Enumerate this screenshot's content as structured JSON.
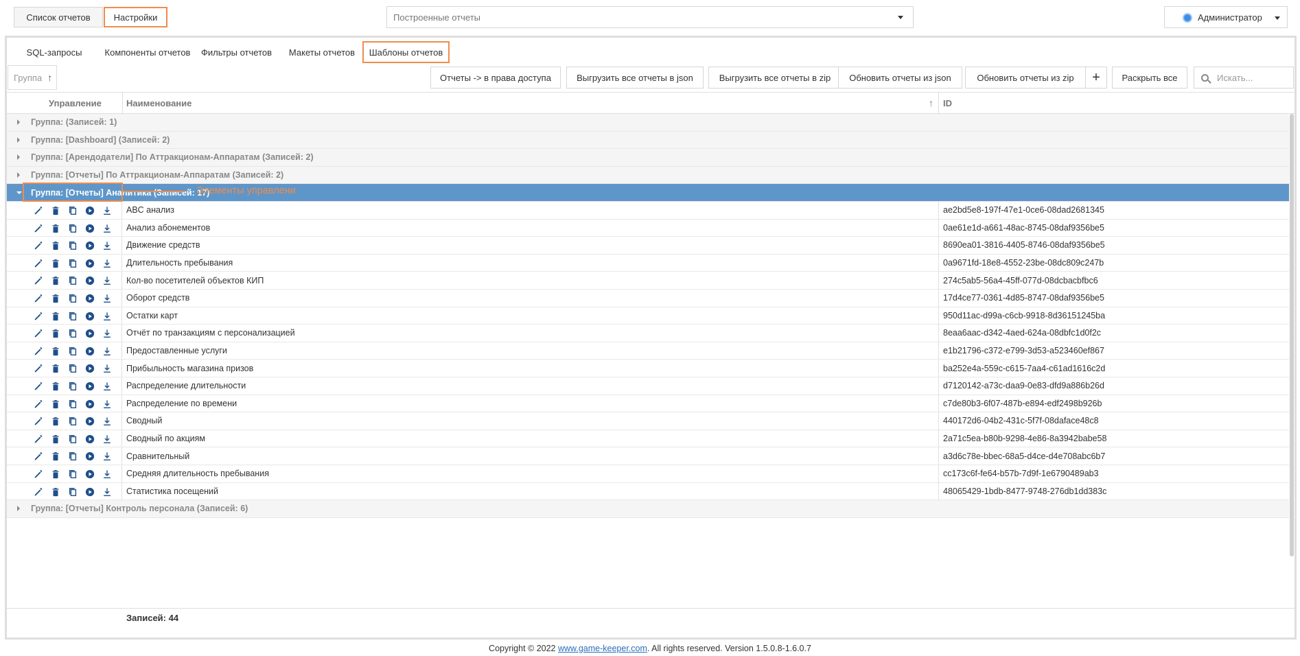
{
  "topbar": {
    "reports_list_label": "Список отчетов",
    "settings_label": "Настройки",
    "combo_placeholder": "Построенные отчеты",
    "user_label": "Администратор"
  },
  "tabs": [
    {
      "label": "SQL-запросы"
    },
    {
      "label": "Компоненты отчетов"
    },
    {
      "label": "Фильтры отчетов"
    },
    {
      "label": "Макеты отчетов"
    },
    {
      "label": "Шаблоны отчетов"
    }
  ],
  "toolbar": {
    "group_label": "Группа",
    "buttons": [
      "Отчеты -> в права доступа",
      "Выгрузить все отчеты в json",
      "Выгрузить все отчеты в zip",
      "Обновить отчеты из json",
      "Обновить отчеты из zip",
      "+",
      "Раскрыть все"
    ],
    "search_placeholder": "Искать..."
  },
  "grid": {
    "columns": [
      "Управление",
      "Наименование",
      "ID"
    ],
    "groups_before": [
      "Группа: (Записей: 1)",
      "Группа: [Dashboard] (Записей: 2)",
      "Группа: [Арендодатели] По Аттракционам-Аппаратам (Записей: 2)",
      "Группа: [Отчеты] По Аттракционам-Аппаратам (Записей: 2)"
    ],
    "open_group": "Группа: [Отчеты] Аналитика (Записей: 17)",
    "rows": [
      {
        "name": "ABC анализ",
        "id": "ae2bd5e8-197f-47e1-0ce6-08dad2681345"
      },
      {
        "name": "Анализ абонементов",
        "id": "0ae61e1d-a661-48ac-8745-08daf9356be5"
      },
      {
        "name": "Движение средств",
        "id": "8690ea01-3816-4405-8746-08daf9356be5"
      },
      {
        "name": "Длительность пребывания",
        "id": "0a9671fd-18e8-4552-23be-08dc809c247b"
      },
      {
        "name": "Кол-во посетителей объектов КИП",
        "id": "274c5ab5-56a4-45ff-077d-08dcbacbfbc6"
      },
      {
        "name": "Оборот средств",
        "id": "17d4ce77-0361-4d85-8747-08daf9356be5"
      },
      {
        "name": "Остатки карт",
        "id": "950d11ac-d99a-c6cb-9918-8d36151245ba"
      },
      {
        "name": "Отчёт по транзакциям с персонализацией",
        "id": "8eaa6aac-d342-4aed-624a-08dbfc1d0f2c"
      },
      {
        "name": "Предоставленные услуги",
        "id": "e1b21796-c372-e799-3d53-a523460ef867"
      },
      {
        "name": "Прибыльность магазина призов",
        "id": "ba252e4a-559c-c615-7aa4-c61ad1616c2d"
      },
      {
        "name": "Распределение длительности",
        "id": "d7120142-a73c-daa9-0e83-dfd9a886b26d"
      },
      {
        "name": "Распределение по времени",
        "id": "c7de80b3-6f07-487b-e894-edf2498b926b"
      },
      {
        "name": "Сводный",
        "id": "440172d6-04b2-431c-5f7f-08daface48c8"
      },
      {
        "name": "Сводный по акциям",
        "id": "2a71c5ea-b80b-9298-4e86-8a3942babe58"
      },
      {
        "name": "Сравнительный",
        "id": "a3d6c78e-bbec-68a5-d4ce-d4e708abc6b7"
      },
      {
        "name": "Средняя длительность пребывания",
        "id": "cc173c6f-fe64-b57b-7d9f-1e6790489ab3"
      },
      {
        "name": "Статистика посещений",
        "id": "48065429-1bdb-8477-9748-276db1dd383c"
      }
    ],
    "groups_after": [
      "Группа: [Отчеты] Контроль персонала (Записей: 6)"
    ],
    "footer_count": "Записей: 44"
  },
  "annotation": "Элементы управлени",
  "footer": {
    "prefix": "Copyright © 2022 ",
    "link": "www.game-keeper.com",
    "suffix": ". All rights reserved.   Version 1.5.0.8-1.6.0.7"
  },
  "colors": {
    "accent_orange": "#f08c4b",
    "selected_group": "#5e96c9",
    "icon_blue": "#1f4f8a"
  },
  "row_icons": [
    "edit-icon",
    "delete-icon",
    "copy-icon",
    "play-icon",
    "download-icon"
  ]
}
